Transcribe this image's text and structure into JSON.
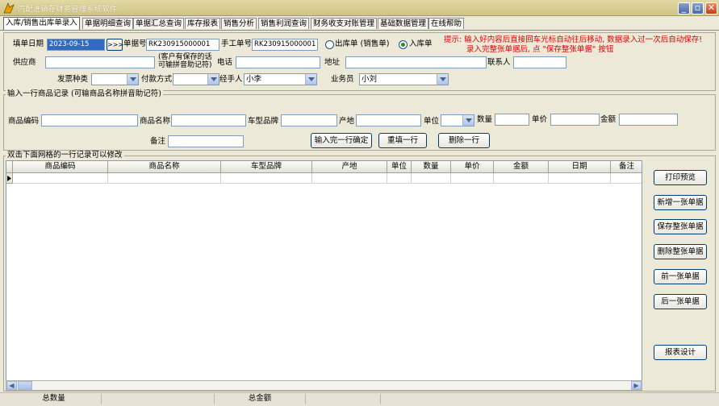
{
  "window": {
    "title": "汽配进销存财务管理系统软件"
  },
  "tabs": [
    "入库/销售出库单录入",
    "单据明细查询",
    "单据汇总查询",
    "库存报表",
    "销售分析",
    "销售利润查询",
    "财务收支对账管理",
    "基础数据管理",
    "在线帮助"
  ],
  "header_form": {
    "date_label": "填单日期",
    "date_value": "2023-09-15",
    "nav_button": ">>>",
    "doc_no_label": "单据号",
    "doc_no_value": "RK230915000001",
    "manual_no_label": "手工单号",
    "manual_no_value": "RK230915000001",
    "radio_out": "出库单 (销售单)",
    "radio_in": "入库单",
    "tip_line1": "提示: 输入好内容后直接回车光标自动往后移动, 数据录入过一次后自动保存!",
    "tip_line2": "录入完整张单据后, 点 \"保存整张单据\" 按钮",
    "supplier_label": "供应商",
    "supplier_hint_1": "(客户有保存的话",
    "supplier_hint_2": "可输拼音助记符)",
    "phone_label": "电话",
    "address_label": "地址",
    "contact_label": "联系人",
    "invoice_label": "发票种类",
    "payment_label": "付款方式",
    "handler_label": "经手人",
    "handler_value": "小李",
    "clerk_label": "业务员",
    "clerk_value": "小刘"
  },
  "item_form": {
    "group_title": "输入一行商品记录 (可输商品名称拼音助记符)",
    "code_label": "商品编码",
    "name_label": "商品名称",
    "model_label": "车型品牌",
    "origin_label": "产地",
    "unit_label": "单位",
    "qty_label": "数量",
    "price_label": "单价",
    "amount_label": "金额",
    "remark_label": "备注",
    "confirm_button": "输入完一行确定",
    "refill_button": "重填一行",
    "delete_button": "删除一行"
  },
  "grid": {
    "group_title": "双击下面网格的一行记录可以修改",
    "columns": [
      "商品编码",
      "商品名称",
      "车型品牌",
      "产地",
      "单位",
      "数量",
      "单价",
      "金额",
      "日期",
      "备注"
    ]
  },
  "side_buttons": {
    "print": "打印预览",
    "new": "新增一张单据",
    "save": "保存整张单据",
    "delete": "删除整张单据",
    "prev": "前一张单据",
    "next": "后一张单据",
    "report": "报表设计"
  },
  "status": {
    "total_qty_label": "总数量",
    "total_amount_label": "总金额"
  },
  "colors": {
    "tip": "#e00000",
    "date_selected": "#316ac5"
  }
}
